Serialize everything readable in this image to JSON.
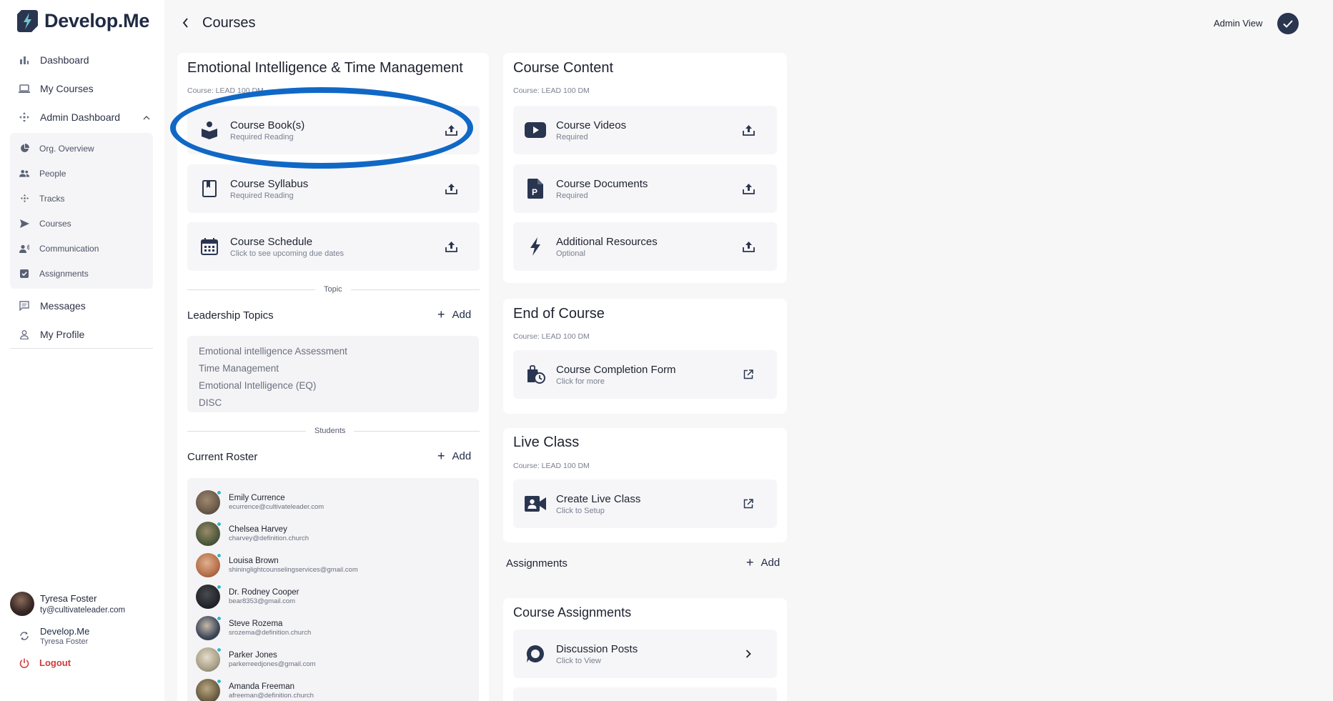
{
  "sidebar": {
    "brand": "Develop.Me",
    "nav": [
      {
        "label": "Dashboard",
        "icon": "bar-chart-icon"
      },
      {
        "label": "My Courses",
        "icon": "laptop-icon"
      },
      {
        "label": "Admin Dashboard",
        "icon": "move-icon"
      }
    ],
    "admin_sub": [
      {
        "label": "Org. Overview",
        "icon": "pie-chart-icon"
      },
      {
        "label": "People",
        "icon": "people-icon"
      },
      {
        "label": "Tracks",
        "icon": "move-icon"
      },
      {
        "label": "Courses",
        "icon": "send-icon"
      },
      {
        "label": "Communication",
        "icon": "speaker-icon"
      },
      {
        "label": "Assignments",
        "icon": "check-box-icon"
      }
    ],
    "nav_bottom": [
      {
        "label": "Messages",
        "icon": "message-icon"
      },
      {
        "label": "My Profile",
        "icon": "person-icon"
      }
    ],
    "user": {
      "name": "Tyresa Foster",
      "email": "ty@cultivateleader.com"
    },
    "org": {
      "name": "Develop.Me",
      "sub": "Tyresa Foster"
    },
    "logout": "Logout"
  },
  "header": {
    "title": "Courses",
    "admin_view": "Admin View"
  },
  "course": {
    "title": "Emotional Intelligence & Time Management",
    "sub": "Course: LEAD 100 DM",
    "tiles": [
      {
        "title": "Course Book(s)",
        "sub": "Required Reading",
        "icon": "book-reader-icon"
      },
      {
        "title": "Course Syllabus",
        "sub": "Required Reading",
        "icon": "bookmark-book-icon"
      },
      {
        "title": "Course Schedule",
        "sub": "Click to see upcoming due dates",
        "icon": "calendar-icon"
      }
    ],
    "topic_divider": "Topic",
    "topics_head": "Leadership Topics",
    "add_label": "Add",
    "topics": [
      "Emotional intelligence Assessment",
      "Time Management",
      "Emotional Intelligence (EQ)",
      "DISC"
    ],
    "students_divider": "Students",
    "roster_head": "Current Roster",
    "students": [
      {
        "name": "Emily Currence",
        "email": "ecurrence@cultivateleader.com",
        "color": "#6b5a4a"
      },
      {
        "name": "Chelsea Harvey",
        "email": "charvey@definition.church",
        "color": "#4f5a3c"
      },
      {
        "name": "Louisa Brown",
        "email": "shininglightcounselingservices@gmail.com",
        "color": "#b5704a"
      },
      {
        "name": "Dr. Rodney Cooper",
        "email": "bear8353@gmail.com",
        "color": "#23262c"
      },
      {
        "name": "Steve Rozema",
        "email": "srozema@definition.church",
        "color": "#3f4a5c"
      },
      {
        "name": "Parker Jones",
        "email": "parkerreedjones@gmail.com",
        "color": "#c8c0a8"
      },
      {
        "name": "Amanda Freeman",
        "email": "afreeman@definition.church",
        "color": "#6d5e44"
      }
    ]
  },
  "content": {
    "title": "Course Content",
    "sub": "Course: LEAD 100 DM",
    "tiles": [
      {
        "title": "Course Videos",
        "sub": "Required",
        "icon": "youtube-icon"
      },
      {
        "title": "Course Documents",
        "sub": "Required",
        "icon": "document-p-icon"
      },
      {
        "title": "Additional Resources",
        "sub": "Optional",
        "icon": "bolt-icon"
      }
    ]
  },
  "end": {
    "title": "End of Course",
    "sub": "Course: LEAD 100 DM",
    "tile": {
      "title": "Course Completion Form",
      "sub": "Click for more",
      "icon": "clock-bag-icon"
    }
  },
  "live": {
    "title": "Live Class",
    "sub": "Course: LEAD 100 DM",
    "tile": {
      "title": "Create Live Class",
      "sub": "Click to Setup",
      "icon": "video-person-icon"
    }
  },
  "assignments": {
    "head": "Assignments",
    "add_label": "Add",
    "card_title": "Course Assignments",
    "tile": {
      "title": "Discussion Posts",
      "sub": "Click to View",
      "icon": "chat-bubble-icon"
    }
  }
}
